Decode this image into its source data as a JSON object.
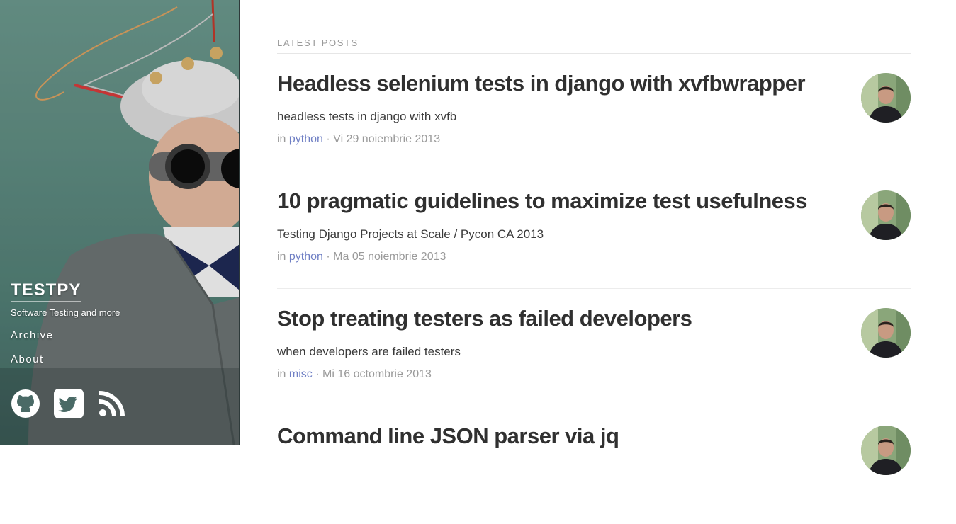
{
  "sidebar": {
    "brand_title": "TESTPY",
    "tagline": "Software Testing and more",
    "nav": [
      {
        "label": "Archive"
      },
      {
        "label": "About"
      }
    ],
    "social_icons": [
      "github-icon",
      "twitter-icon",
      "rss-icon"
    ]
  },
  "main": {
    "section_heading": "LATEST POSTS",
    "posts": [
      {
        "title": "Headless selenium tests in django with xvfbwrapper",
        "subtitle": "headless tests in django with xvfb",
        "meta_prefix": "in",
        "category": "python",
        "date": "· Vi 29 noiembrie 2013"
      },
      {
        "title": "10 pragmatic guidelines to maximize test usefulness",
        "subtitle": "Testing Django Projects at Scale / Pycon CA 2013",
        "meta_prefix": "in",
        "category": "python",
        "date": "· Ma 05 noiembrie 2013"
      },
      {
        "title": "Stop treating testers as failed developers",
        "subtitle": "when developers are failed testers",
        "meta_prefix": "in",
        "category": "misc",
        "date": "· Mi 16 octombrie 2013"
      },
      {
        "title": "Command line JSON parser via jq",
        "subtitle": "",
        "meta_prefix": "",
        "category": "",
        "date": ""
      }
    ]
  },
  "colors": {
    "link": "#6f7fc4",
    "title": "#303030",
    "muted": "#9a9a9a"
  }
}
